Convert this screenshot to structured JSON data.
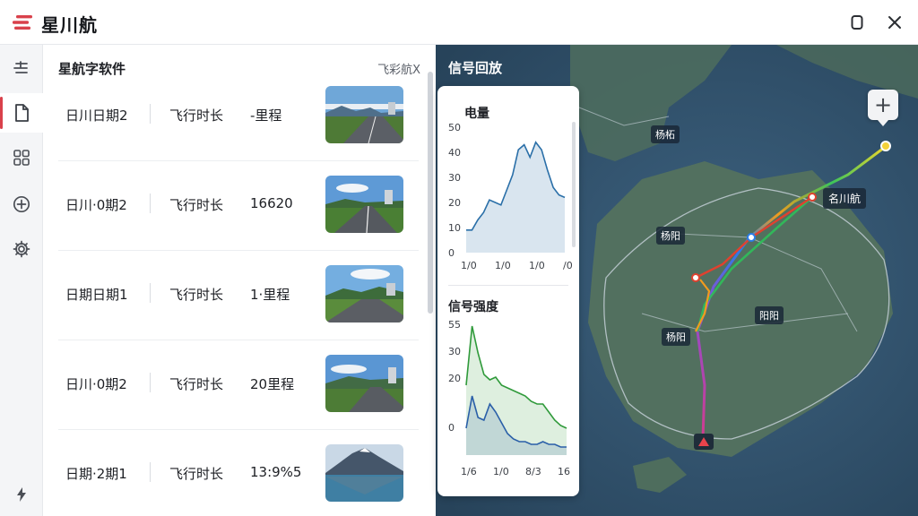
{
  "app": {
    "title": "星川航"
  },
  "panel": {
    "title": "星航字软件",
    "right_label": "飞彩航X"
  },
  "rows": [
    {
      "date": "日川日期2",
      "label": "飞行时长",
      "value": "-里程"
    },
    {
      "date": "日川·0期2",
      "label": "飞行时长",
      "value": "16620"
    },
    {
      "date": "日期日期1",
      "label": "飞行时长",
      "value": "1·里程"
    },
    {
      "date": "日川·0期2",
      "label": "飞行时长",
      "value": "20里程"
    },
    {
      "date": "日期·2期1",
      "label": "飞行时长",
      "value": "13:9%5"
    }
  ],
  "map": {
    "title": "信号回放",
    "labels": [
      "杨柘",
      "杨阳",
      "名川航",
      "阳阳",
      "杨阳"
    ],
    "zoom_label": "+"
  },
  "chart_data": [
    {
      "type": "area",
      "title": "电量",
      "y_ticks": [
        "50",
        "40",
        "30",
        "20",
        "10",
        "0"
      ],
      "x_ticks": [
        "1/0",
        "1/0",
        "1/0",
        "/0"
      ],
      "ylim": [
        0,
        50
      ],
      "series": [
        {
          "values": [
            9,
            9,
            13,
            16,
            21,
            20,
            19,
            25,
            31,
            41,
            43,
            38,
            44,
            41,
            33,
            26,
            23,
            22
          ]
        }
      ]
    },
    {
      "type": "area",
      "title": "信号强度",
      "y_ticks": [
        "55",
        "30",
        "20",
        "0"
      ],
      "x_ticks": [
        "1/6",
        "1/0",
        "8/3",
        "16"
      ],
      "series": [
        {
          "color": "#2f9a3a",
          "values": [
            26,
            48,
            38,
            30,
            28,
            29,
            26,
            25,
            24,
            23,
            22,
            20,
            19,
            19,
            16,
            13,
            11,
            10
          ]
        },
        {
          "color": "#2a5fa8",
          "values": [
            10,
            22,
            14,
            13,
            19,
            16,
            12,
            8,
            6,
            5,
            5,
            4,
            4,
            5,
            4,
            4,
            3,
            3
          ]
        }
      ]
    }
  ],
  "colors": {
    "accent": "#d9414b",
    "map_water": "#2f4f67",
    "map_land": "#52705f"
  }
}
